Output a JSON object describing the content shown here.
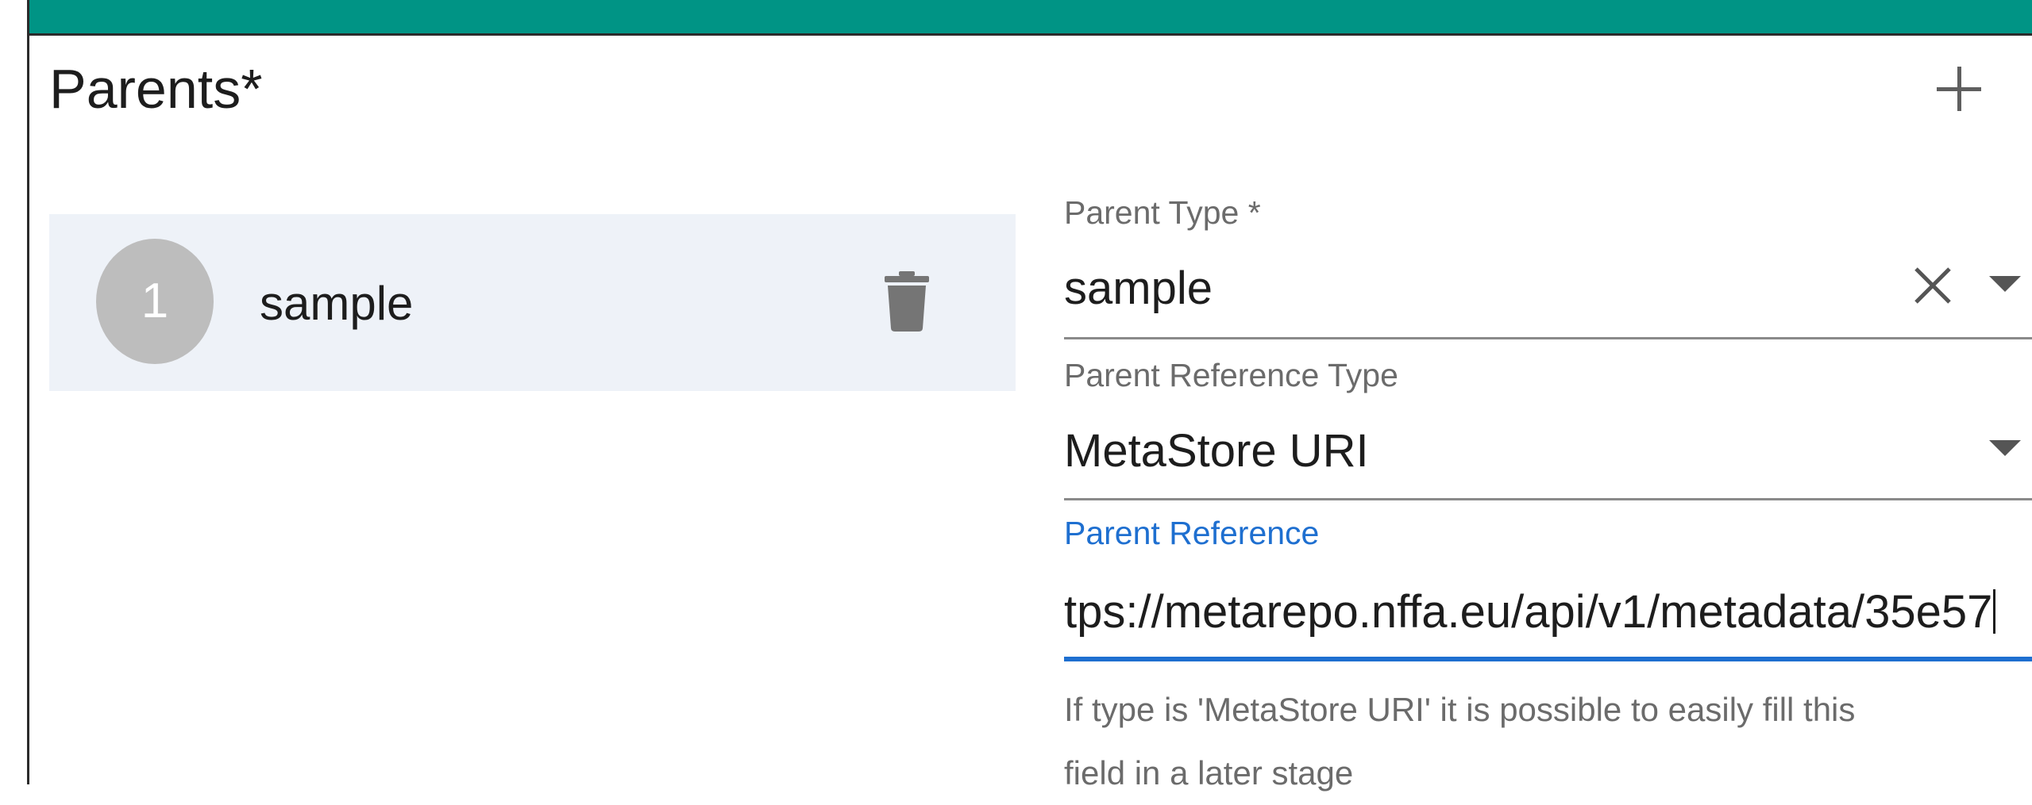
{
  "section": {
    "title": "Parents*"
  },
  "parents_list": [
    {
      "index": "1",
      "label": "sample"
    }
  ],
  "form": {
    "parent_type": {
      "label": "Parent Type *",
      "value": "sample"
    },
    "parent_reference_type": {
      "label": "Parent Reference Type",
      "value": "MetaStore URI"
    },
    "parent_reference": {
      "label": "Parent Reference",
      "value": "tps://metarepo.nffa.eu/api/v1/metadata/35e57",
      "helper_line_1": "If type is 'MetaStore URI' it is possible to easily fill this",
      "helper_line_2": "field in a later stage"
    }
  },
  "icons": {
    "add": "plus-icon",
    "delete": "trash-icon",
    "clear": "close-icon",
    "dropdown": "caret-down-icon"
  },
  "colors": {
    "header_band": "#009485",
    "focus_accent": "#1e6fd0",
    "list_item_bg": "#eef2f8",
    "avatar_bg": "#bdbdbd"
  }
}
